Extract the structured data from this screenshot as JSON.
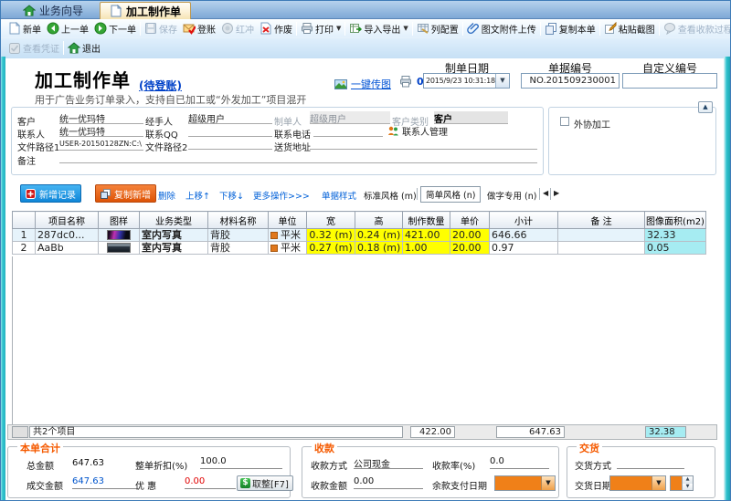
{
  "tabs": [
    {
      "label": "业务向导"
    },
    {
      "label": "加工制作单"
    }
  ],
  "toolbar": {
    "row1": [
      {
        "label": "新单"
      },
      {
        "label": "上一单"
      },
      {
        "label": "下一单"
      },
      {
        "label": "保存"
      },
      {
        "label": "登账"
      },
      {
        "label": "红冲"
      },
      {
        "label": "作废"
      },
      {
        "label": "打印"
      },
      {
        "label": "导入导出"
      },
      {
        "label": "列配置"
      },
      {
        "label": "图文附件上传"
      },
      {
        "label": "复制本单"
      },
      {
        "label": "粘贴截图"
      },
      {
        "label": "查看收款过程"
      }
    ],
    "row2": [
      {
        "label": "查看凭证"
      },
      {
        "label": "退出"
      }
    ]
  },
  "header": {
    "title": "加工制作单",
    "status": "(待登账)",
    "subtitle": "用于广告业务订单录入，支持自已加工或“外发加工”项目混开",
    "send_image": "一键传图",
    "print_count": "0",
    "date_label": "制单日期",
    "date_value": "2015/9/23 10:31:18",
    "doc_label": "单据编号",
    "doc_value": "NO.201509230001",
    "custom_label": "自定义编号"
  },
  "form": {
    "customer_label": "客户",
    "customer": "统一优玛特",
    "handler_label": "经手人",
    "handler": "超级用户",
    "creator_label": "制单人",
    "creator": "超级用户",
    "customer_type_label": "客户类别",
    "customer_type": "客户",
    "contact_label": "联系人",
    "contact": "统一优玛特",
    "qq_label": "联系QQ",
    "phone_label": "联系电话",
    "contact_manage": "联系人管理",
    "path1_label": "文件路径1",
    "path1": "USER-20150128ZN:C:\\",
    "path2_label": "文件路径2",
    "address_label": "送货地址",
    "remark_label": "备注",
    "outsource_label": "外协加工"
  },
  "record_toolbar": {
    "add": "新增记录",
    "copy": "复制新增",
    "delete": "删除",
    "up": "上移↑",
    "down": "下移↓",
    "more": "更多操作>>>",
    "style": "单据样式",
    "styles": [
      "标准风格 (m)",
      "简单风格 (n)",
      "做字专用 (n)"
    ]
  },
  "table": {
    "headers": [
      "",
      "项目名称",
      "图样",
      "业务类型",
      "材料名称",
      "单位",
      "宽",
      "高",
      "制作数量",
      "单价",
      "小计",
      "备 注",
      "图像面积(m2)"
    ],
    "rows": [
      {
        "num": "1",
        "name": "287dc0...",
        "type": "室内写真",
        "material": "背胶",
        "unit": "平米",
        "width": "0.32 (m)",
        "height": "0.24 (m)",
        "qty": "421.00",
        "price": "20.00",
        "subtotal": "646.66",
        "remark": "",
        "area": "32.33"
      },
      {
        "num": "2",
        "name": "AaBb",
        "type": "室内写真",
        "material": "背胶",
        "unit": "平米",
        "width": "0.27 (m)",
        "height": "0.18 (m)",
        "qty": "1.00",
        "price": "20.00",
        "subtotal": "0.97",
        "remark": "",
        "area": "0.05"
      }
    ],
    "summary": {
      "count": "共2个项目",
      "qty": "422.00",
      "subtotal": "647.63",
      "area": "32.38"
    }
  },
  "panels": {
    "total": {
      "title": "本单合计",
      "amount_label": "总金额",
      "amount": "647.63",
      "discount_label": "整单折扣(%)",
      "discount": "100.0",
      "deal_label": "成交金额",
      "deal": "647.63",
      "off_label": "优 惠",
      "off": "0.00",
      "round_btn": "取整[F7]"
    },
    "payment": {
      "title": "收款",
      "method_label": "收款方式",
      "method": "公司现金",
      "rate_label": "收款率(%)",
      "rate": "0.0",
      "amount_label": "收款金额",
      "amount": "0.00",
      "balance_label": "余款支付日期"
    },
    "delivery": {
      "title": "交货",
      "method_label": "交货方式",
      "date_label": "交货日期"
    }
  },
  "colors": {
    "accent_orange": "#f55a00",
    "highlight_yellow": "#ffff00",
    "highlight_cyan": "#a6ecf2",
    "frame_teal": "#2fc3ce",
    "link_blue": "#0052d4"
  }
}
